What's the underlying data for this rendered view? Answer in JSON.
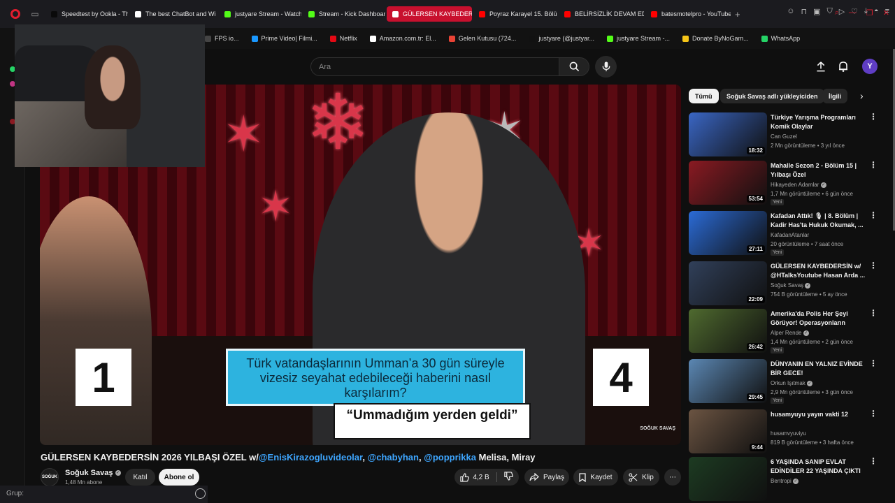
{
  "browser": {
    "tabs": [
      {
        "label": "Speedtest by Ookla - The",
        "color": "#0a0a0a",
        "active": false
      },
      {
        "label": "The best ChatBot and Wi",
        "color": "#ffffff",
        "active": false
      },
      {
        "label": "justyare Stream - Watch L",
        "color": "#53fc18",
        "active": false
      },
      {
        "label": "Stream - Kick Dashboard",
        "color": "#53fc18",
        "active": false
      },
      {
        "label": "GÜLERSEN KAYBEDER",
        "color": "#ff0000",
        "active": true
      },
      {
        "label": "Poyraz Karayel 15. Bölüm",
        "color": "#ff0000",
        "active": false
      },
      {
        "label": "BELİRSİZLİK DEVAM EDİY",
        "color": "#ff0000",
        "active": false
      },
      {
        "label": "batesmotelpro - YouTube",
        "color": "#ff0000",
        "active": false
      }
    ],
    "new_tab": "+",
    "bookmarks": [
      {
        "label": "FPS io...",
        "color": "#444444"
      },
      {
        "label": "Prime Video| Filmi...",
        "color": "#1a98ff"
      },
      {
        "label": "Netflix",
        "color": "#e50914"
      },
      {
        "label": "Amazon.com.tr: El...",
        "color": "#ffffff"
      },
      {
        "label": "Gelen Kutusu (724...",
        "color": "#ea4335"
      },
      {
        "label": "justyare (@justyar...",
        "color": "#111111"
      },
      {
        "label": "justyare Stream -...",
        "color": "#53fc18"
      },
      {
        "label": "Donate ByNoGam...",
        "color": "#f5c518"
      },
      {
        "label": "WhatsApp",
        "color": "#25d366"
      }
    ],
    "group_label": "Grup:"
  },
  "youtube": {
    "search_placeholder": "Ara",
    "avatar_letter": "Y",
    "video": {
      "title_prefix": "GÜLERSEN KAYBEDERSİN 2026 YILBAŞI ÖZEL w/",
      "mention1": "@EnisKirazogluvideolar",
      "sep1": ", ",
      "mention2": "@chabyhan",
      "sep2": ", ",
      "mention3": "@popprikka",
      "title_suffix": " Melisa, Miray",
      "overlay_score_left": "1",
      "overlay_score_right": "4",
      "overlay_question": "Türk vatandaşlarının Umman’a 30 gün süreyle vizesiz seyahat edebileceği haberini nasıl karşılarım?",
      "overlay_answer": "“Ummadığım yerden geldi”",
      "watermark": "SOĞUK SAVAŞ"
    },
    "channel": {
      "logo_text": "SOĞUK",
      "name": "Soğuk Savaş",
      "subs": "1,48 Mn abone",
      "join_label": "Katıl",
      "subscribe_label": "Abone ol"
    },
    "actions": {
      "likes": "4,2 B",
      "share": "Paylaş",
      "save": "Kaydet",
      "clip": "Klip",
      "more": "⋯"
    },
    "chips": [
      "Tümü",
      "Soğuk Savaş adlı yükleyiciden",
      "İlgili"
    ],
    "recommendations": [
      {
        "title": "Türkiye Yarışma Programları Komik Olaylar",
        "channel": "Can Guzel",
        "verified": false,
        "meta": "2 Mn görüntüleme • 3 yıl önce",
        "duration": "18:32",
        "badge": "",
        "thumb": "#3a66c4"
      },
      {
        "title": "Mahalle Sezon 2 - Bölüm 15 | Yılbaşı Özel",
        "channel": "Hikayeden Adamlar",
        "verified": true,
        "meta": "1,7 Mn görüntüleme • 6 gün önce",
        "duration": "53:54",
        "badge": "Yeni",
        "thumb": "#8a1a22"
      },
      {
        "title": "Kafadan Attık! 🎙 | 8. Bölüm | Kadir Has'ta Hukuk Okumak, ...",
        "channel": "KafadanAtanlar",
        "verified": false,
        "meta": "20 görüntüleme • 7 saat önce",
        "duration": "27:11",
        "badge": "Yeni",
        "thumb": "#2b6bd6"
      },
      {
        "title": "GÜLERSEN KAYBEDERSİN w/ @HTalksYoutube Hasan Arda ...",
        "channel": "Soğuk Savaş",
        "verified": true,
        "meta": "754 B görüntüleme • 5 ay önce",
        "duration": "22:09",
        "badge": "",
        "thumb": "#31405a"
      },
      {
        "title": "Amerika'da Polis Her Şeyi Görüyor! Operasyonların Perde...",
        "channel": "Alper Rende",
        "verified": true,
        "meta": "1,4 Mn görüntüleme • 2 gün önce",
        "duration": "26:42",
        "badge": "Yeni",
        "thumb": "#4f6a2f"
      },
      {
        "title": "DÜNYANIN EN YALNIZ EVİNDE BİR GECE!",
        "channel": "Orkun Işıtmak",
        "verified": true,
        "meta": "2,9 Mn görüntüleme • 3 gün önce",
        "duration": "29:45",
        "badge": "Yeni",
        "thumb": "#5b87b3"
      },
      {
        "title": "husamyuyu yayın vakti 12",
        "channel": "husamvyuviyu",
        "verified": false,
        "meta": "819 B görüntüleme • 3 hafta önce",
        "duration": "9:44",
        "badge": "",
        "thumb": "#6b5442"
      },
      {
        "title": "6 YAŞINDA SANIP EVLAT EDİNDİLER 22 YAŞINDA ÇIKTI",
        "channel": "Bentropi",
        "verified": true,
        "meta": "",
        "duration": "",
        "badge": "",
        "thumb": "#1d3b22"
      }
    ]
  }
}
